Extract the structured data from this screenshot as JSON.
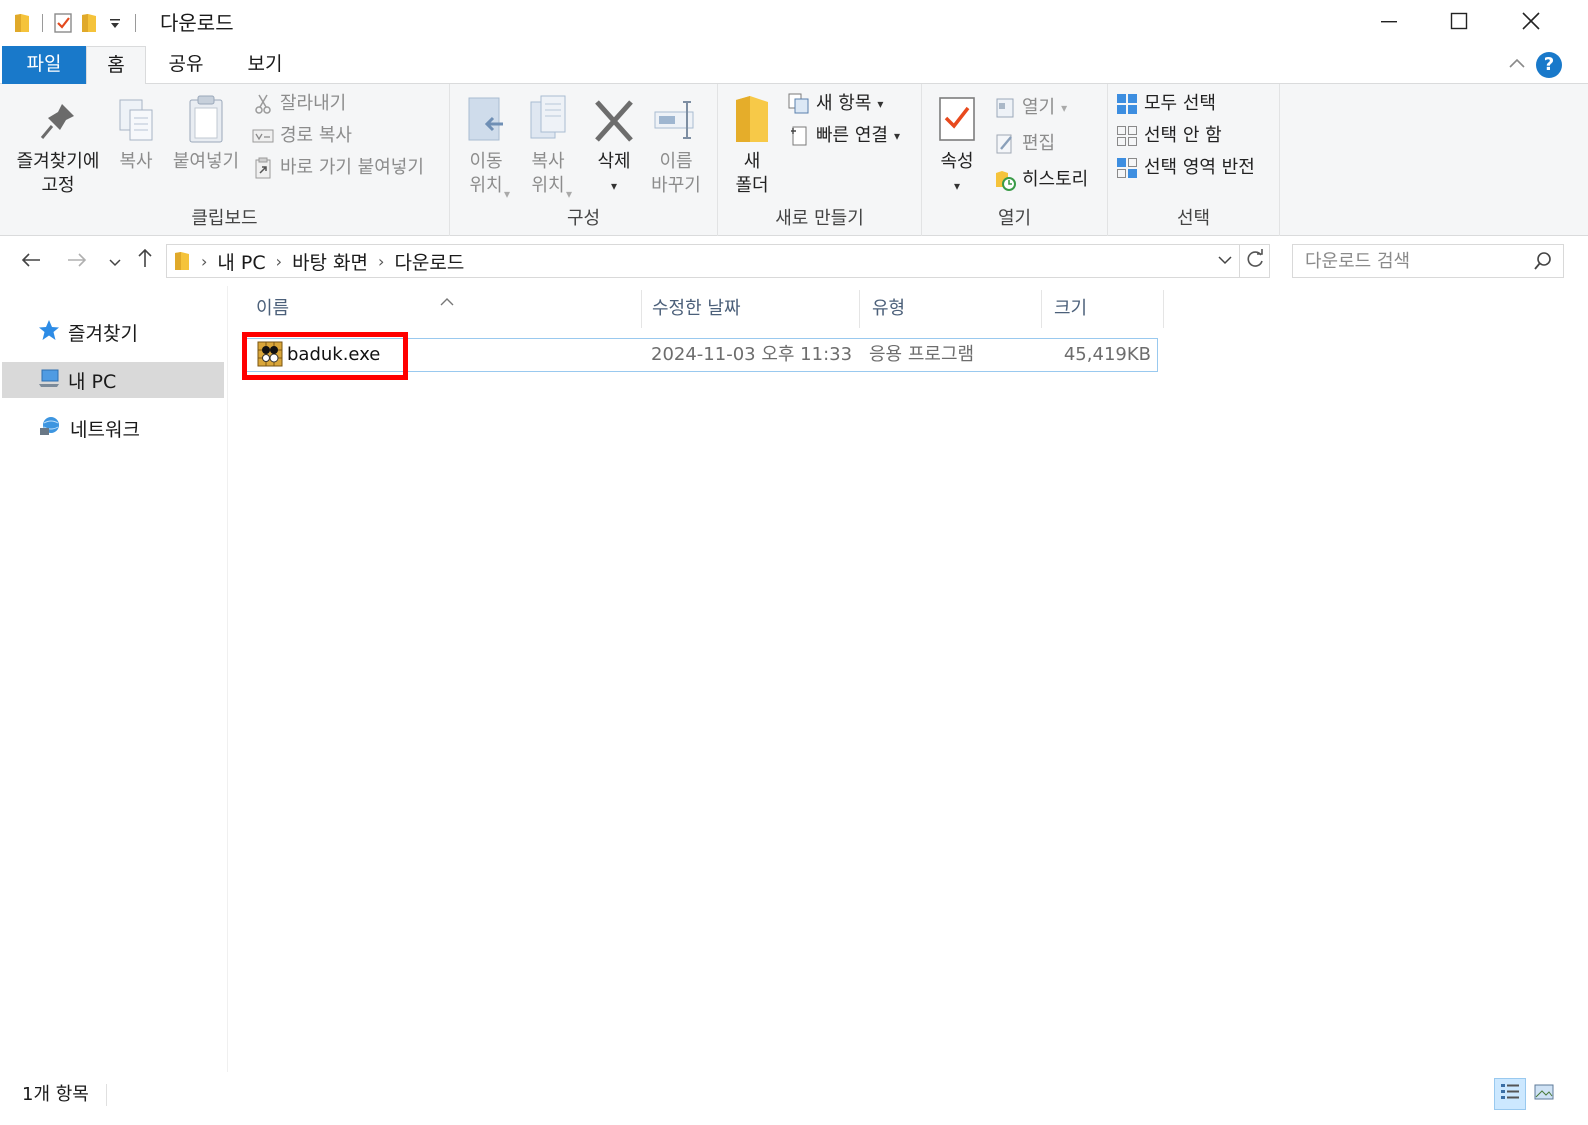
{
  "window": {
    "title": "다운로드",
    "controls": [
      "minimize-icon",
      "maximize-icon",
      "close-icon"
    ]
  },
  "quick_access": [
    "folder-icon",
    "properties-icon",
    "new-folder-icon",
    "customize-dropdown-icon"
  ],
  "tabs": {
    "file": "파일",
    "home": "홈",
    "share": "공유",
    "view": "보기"
  },
  "ribbon": {
    "clipboard": {
      "label": "클립보드",
      "pin": "즐겨찾기에\n고정",
      "copy": "복사",
      "paste": "붙여넣기",
      "cut": "잘라내기",
      "copy_path": "경로 복사",
      "paste_shortcut": "바로 가기 붙여넣기"
    },
    "organize": {
      "label": "구성",
      "move_to": "이동\n위치",
      "copy_to": "복사\n위치",
      "delete": "삭제",
      "rename": "이름\n바꾸기"
    },
    "new": {
      "label": "새로 만들기",
      "new_folder": "새\n폴더",
      "new_item": "새 항목",
      "easy_access": "빠른 연결"
    },
    "open": {
      "label": "열기",
      "properties": "속성",
      "open": "열기",
      "edit": "편집",
      "history": "히스토리"
    },
    "select": {
      "label": "선택",
      "select_all": "모두 선택",
      "select_none": "선택 안 함",
      "invert": "선택 영역 반전"
    }
  },
  "address": {
    "crumbs": [
      "내 PC",
      "바탕 화면",
      "다운로드"
    ],
    "search_placeholder": "다운로드 검색"
  },
  "nav_pane": [
    {
      "label": "즐겨찾기",
      "icon": "star-icon"
    },
    {
      "label": "내 PC",
      "icon": "computer-icon",
      "selected": true
    },
    {
      "label": "네트워크",
      "icon": "network-icon"
    }
  ],
  "columns": [
    "이름",
    "수정한 날짜",
    "유형",
    "크기"
  ],
  "files": [
    {
      "name": "baduk.exe",
      "modified": "2024-11-03 오후 11:33",
      "type": "응용 프로그램",
      "size": "45,419KB",
      "icon": "baduk-app-icon"
    }
  ],
  "status": {
    "item_count": "1개 항목"
  },
  "colors": {
    "accent": "#1979ca",
    "selection_border": "#99c9ef",
    "highlight_box": "#ff0000",
    "ribbon_bg": "#f5f6f7"
  }
}
